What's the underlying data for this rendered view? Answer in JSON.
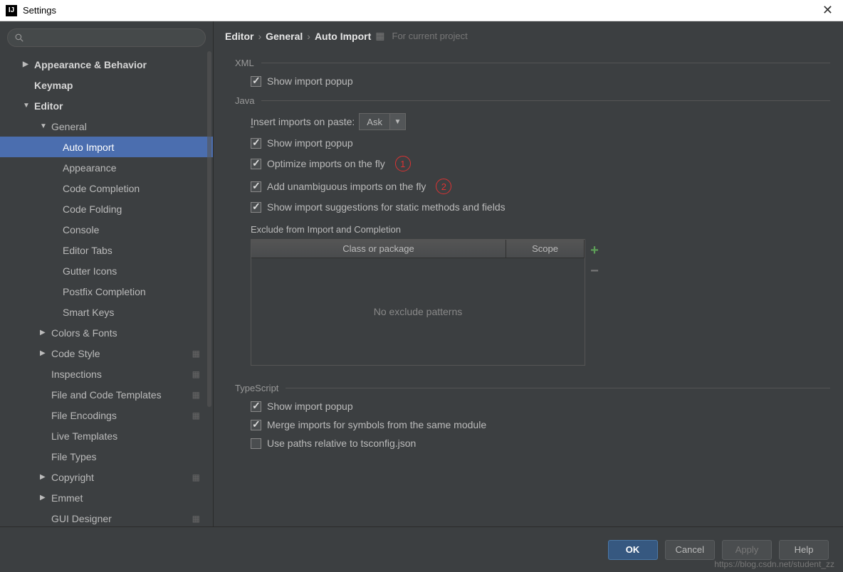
{
  "window": {
    "title": "Settings"
  },
  "search": {
    "placeholder": ""
  },
  "sidebar": {
    "items": [
      {
        "label": "Appearance & Behavior",
        "level": 1,
        "arrow": "▶",
        "bold": true
      },
      {
        "label": "Keymap",
        "level": 1,
        "arrow": "",
        "bold": true
      },
      {
        "label": "Editor",
        "level": 1,
        "arrow": "▼",
        "bold": true
      },
      {
        "label": "General",
        "level": 2,
        "arrow": "▼"
      },
      {
        "label": "Auto Import",
        "level": 3,
        "selected": true
      },
      {
        "label": "Appearance",
        "level": 3
      },
      {
        "label": "Code Completion",
        "level": 3
      },
      {
        "label": "Code Folding",
        "level": 3
      },
      {
        "label": "Console",
        "level": 3
      },
      {
        "label": "Editor Tabs",
        "level": 3
      },
      {
        "label": "Gutter Icons",
        "level": 3
      },
      {
        "label": "Postfix Completion",
        "level": 3
      },
      {
        "label": "Smart Keys",
        "level": 3
      },
      {
        "label": "Colors & Fonts",
        "level": 2,
        "arrow": "▶"
      },
      {
        "label": "Code Style",
        "level": 2,
        "arrow": "▶",
        "proj": true
      },
      {
        "label": "Inspections",
        "level": 2,
        "proj": true
      },
      {
        "label": "File and Code Templates",
        "level": 2,
        "proj": true
      },
      {
        "label": "File Encodings",
        "level": 2,
        "proj": true
      },
      {
        "label": "Live Templates",
        "level": 2
      },
      {
        "label": "File Types",
        "level": 2
      },
      {
        "label": "Copyright",
        "level": 2,
        "arrow": "▶",
        "proj": true
      },
      {
        "label": "Emmet",
        "level": 2,
        "arrow": "▶"
      },
      {
        "label": "GUI Designer",
        "level": 2,
        "proj": true
      }
    ]
  },
  "breadcrumb": {
    "p1": "Editor",
    "p2": "General",
    "p3": "Auto Import",
    "hint": "For current project"
  },
  "sections": {
    "xml": {
      "title": "XML",
      "show_popup": "Show import popup"
    },
    "java": {
      "title": "Java",
      "insert_label": "Insert imports on paste:",
      "insert_value": "Ask",
      "show_popup": "Show import popup",
      "optimize": "Optimize imports on the fly",
      "add_unambiguous": "Add unambiguous imports on the fly",
      "show_suggest": "Show import suggestions for static methods and fields",
      "exclude_title": "Exclude from Import and Completion",
      "col_class": "Class or package",
      "col_scope": "Scope",
      "empty_text": "No exclude patterns",
      "annot1": "1",
      "annot2": "2"
    },
    "ts": {
      "title": "TypeScript",
      "show_popup": "Show import popup",
      "merge": "Merge imports for symbols  from the same module",
      "use_paths": "Use paths relative to tsconfig.json"
    }
  },
  "footer": {
    "ok": "OK",
    "cancel": "Cancel",
    "apply": "Apply",
    "help": "Help"
  },
  "watermark": "https://blog.csdn.net/student_zz"
}
